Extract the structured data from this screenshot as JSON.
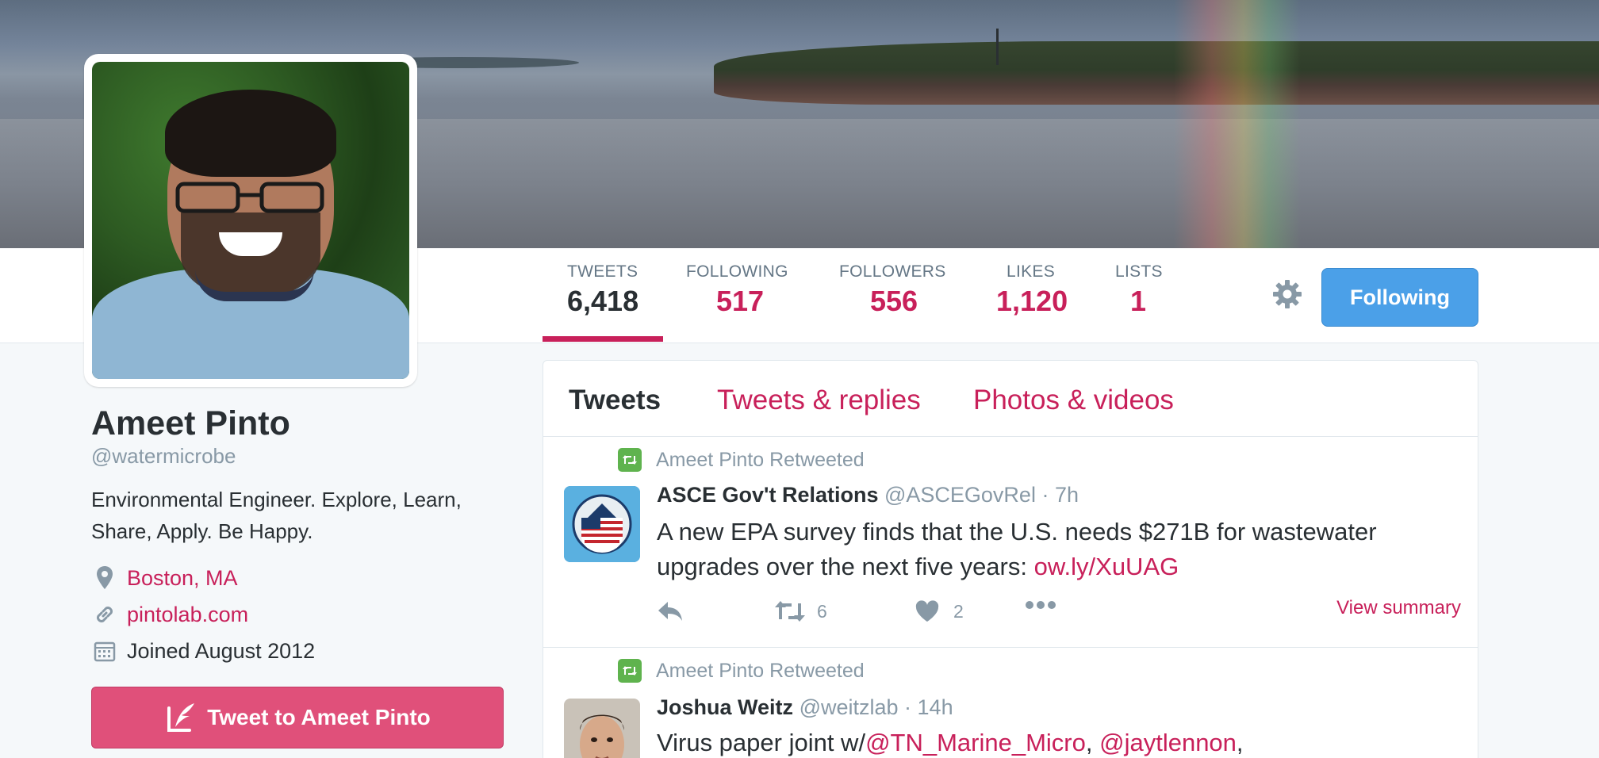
{
  "profile": {
    "name": "Ameet Pinto",
    "handle": "@watermicrobe",
    "bio": "Environmental Engineer. Explore, Learn, Share, Apply. Be Happy.",
    "location": "Boston, MA",
    "website": "pintolab.com",
    "joined": "Joined August 2012",
    "tweet_to_label": "Tweet to Ameet Pinto"
  },
  "stats": [
    {
      "label": "TWEETS",
      "value": "6,418"
    },
    {
      "label": "FOLLOWING",
      "value": "517"
    },
    {
      "label": "FOLLOWERS",
      "value": "556"
    },
    {
      "label": "LIKES",
      "value": "1,120"
    },
    {
      "label": "LISTS",
      "value": "1"
    }
  ],
  "following_button": "Following",
  "tabs": [
    "Tweets",
    "Tweets & replies",
    "Photos & videos"
  ],
  "tweets": [
    {
      "retweeted_by": "Ameet Pinto Retweeted",
      "author": "ASCE Gov't Relations",
      "handle": "@ASCEGovRel",
      "time": "· 7h",
      "text": "A new EPA survey finds that the U.S. needs $271B for wastewater upgrades over the next five years:",
      "link": "ow.ly/XuUAG",
      "retweets": "6",
      "likes": "2",
      "view_summary": "View summary"
    },
    {
      "retweeted_by": "Ameet Pinto Retweeted",
      "author": "Joshua Weitz",
      "handle": "@weitzlab",
      "time": "· 14h",
      "text_prefix": "Virus paper joint w/",
      "mention1": "@TN_Marine_Micro",
      "sep1": ", ",
      "mention2": "@jaytlennon",
      "sep2": ","
    }
  ],
  "colors": {
    "accent": "#c8205a",
    "follow_button": "#4ba0e8",
    "tweet_to_button": "#e0507a",
    "retweet_green": "#5fb34e"
  }
}
